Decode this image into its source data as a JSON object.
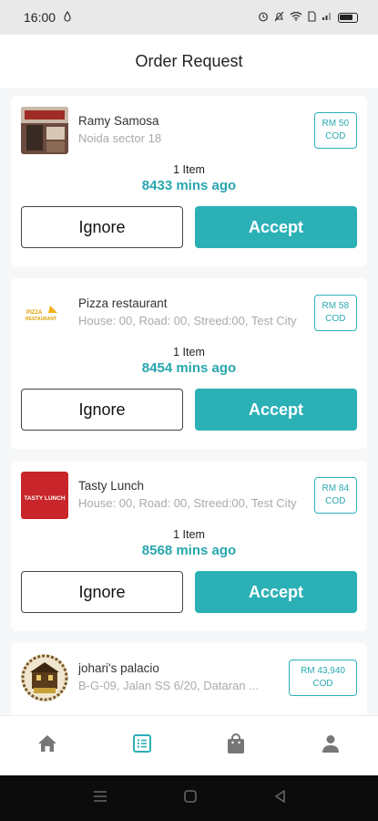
{
  "status_bar": {
    "time": "16:00",
    "icons": [
      "alarm-icon",
      "bell-icon",
      "wifi-icon",
      "signal-icon",
      "battery-icon"
    ]
  },
  "header": {
    "title": "Order Request"
  },
  "orders": [
    {
      "name": "Ramy Samosa",
      "address": "Noida sector 18",
      "price": "RM 50",
      "payment": "COD",
      "items": "1 Item",
      "time_ago": "8433 mins ago",
      "ignore_label": "Ignore",
      "accept_label": "Accept"
    },
    {
      "name": "Pizza restaurant",
      "address": "House: 00, Road: 00, Streed:00, Test City",
      "price": "RM 58",
      "payment": "COD",
      "items": "1 Item",
      "time_ago": "8454 mins ago",
      "ignore_label": "Ignore",
      "accept_label": "Accept",
      "logo_text": [
        "PIZZA",
        "RESTAURANT"
      ]
    },
    {
      "name": "Tasty Lunch",
      "address": "House: 00, Road: 00, Streed:00, Test City",
      "price": "RM 84",
      "payment": "COD",
      "items": "1 Item",
      "time_ago": "8568 mins ago",
      "ignore_label": "Ignore",
      "accept_label": "Accept",
      "logo_text": "TASTY LUNCH"
    },
    {
      "name": "johari's palacio",
      "address": "B-G-09, Jalan SS 6/20, Dataran ...",
      "price": "RM 43,940",
      "payment": "COD"
    }
  ],
  "bottom_nav": {
    "items": [
      "home-icon",
      "orders-list-icon",
      "shopping-bag-icon",
      "profile-icon"
    ],
    "active": "orders-list-icon"
  },
  "colors": {
    "accent": "#2bb0b6",
    "background": "#f6f7f8",
    "muted_text": "#aaaaaa"
  }
}
